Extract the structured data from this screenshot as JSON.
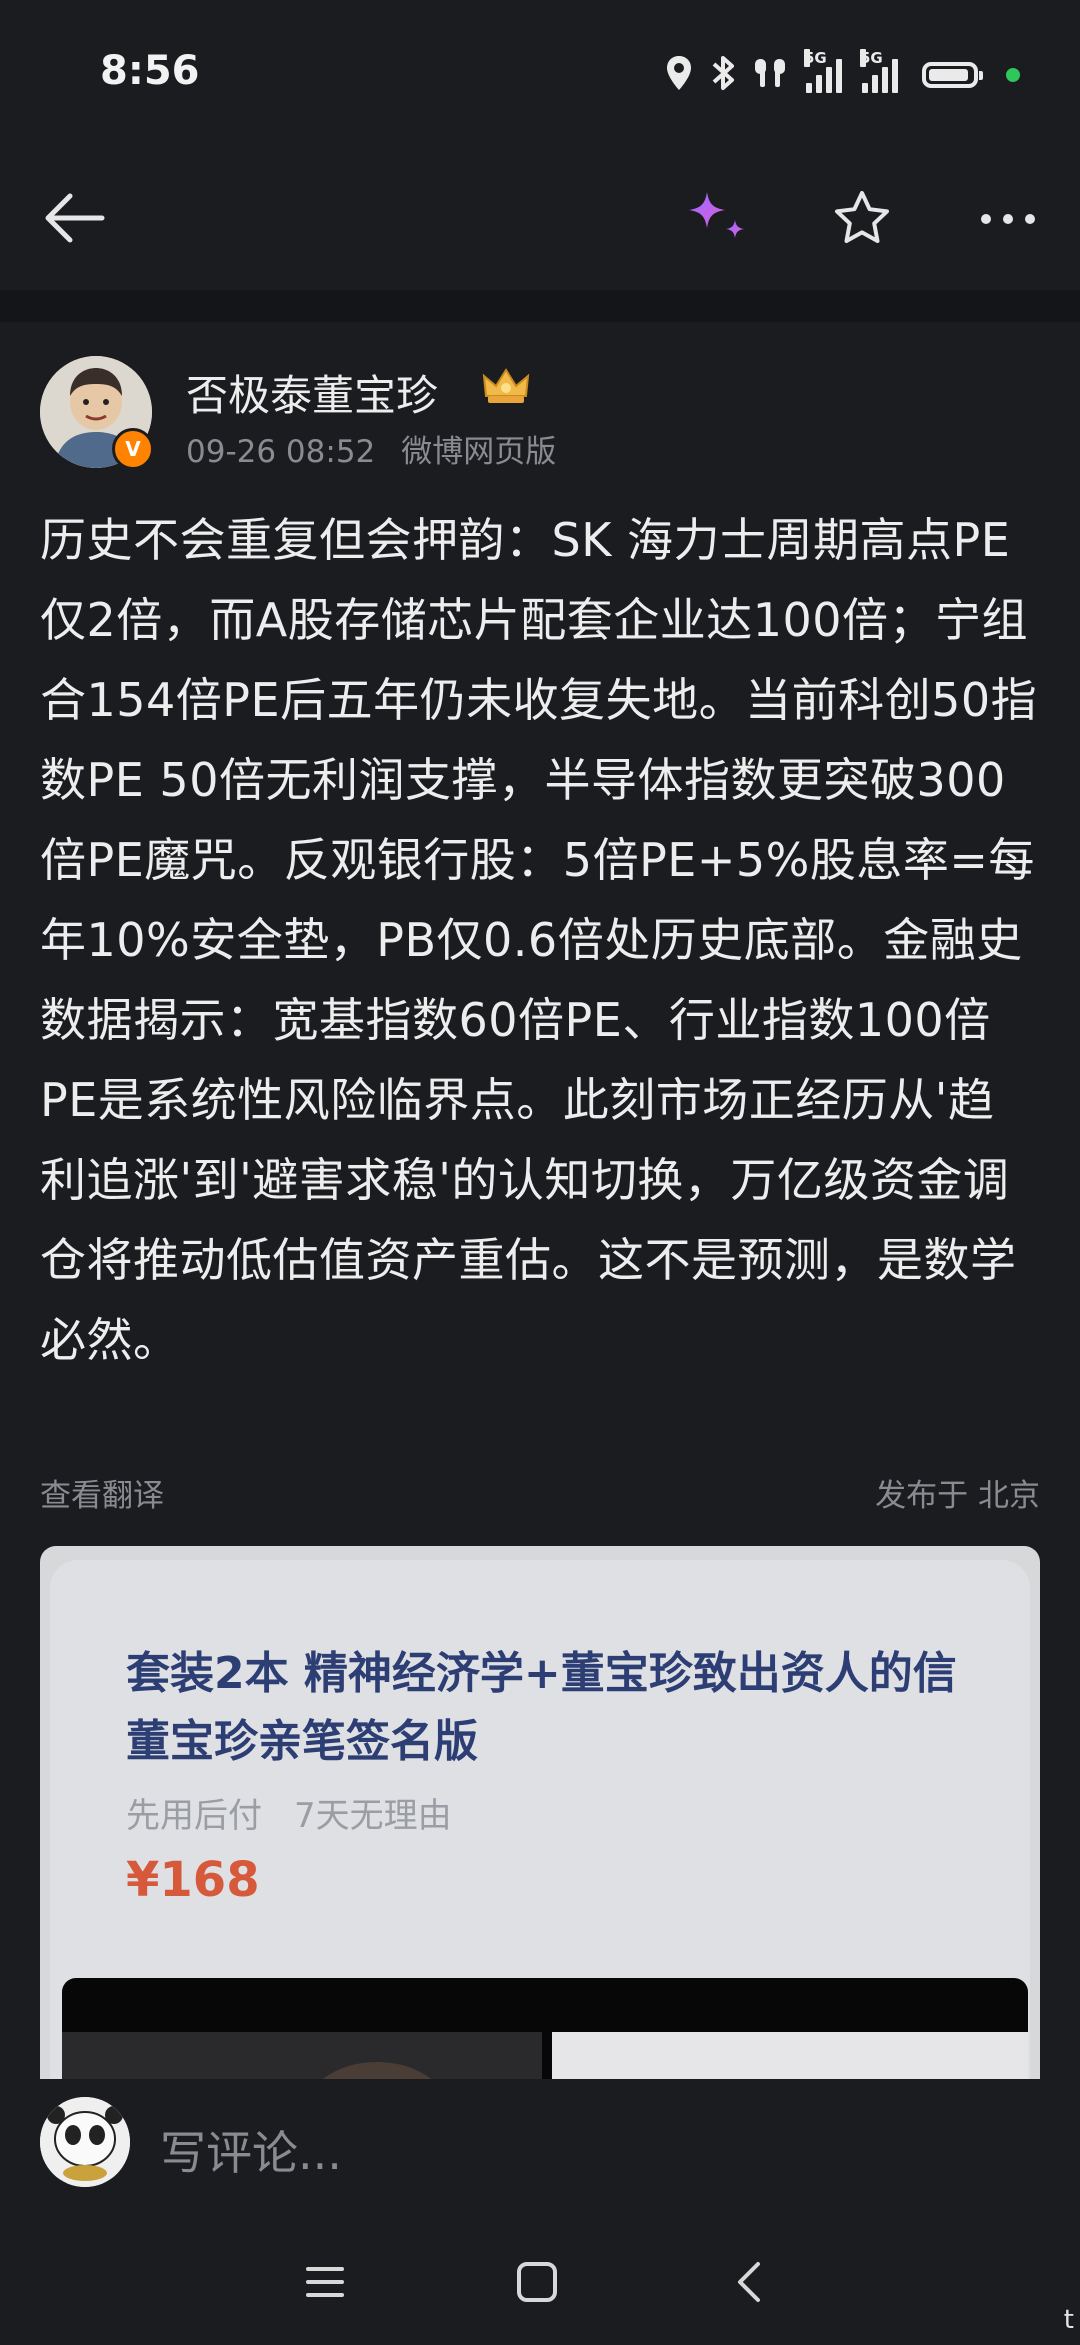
{
  "status_bar": {
    "time": "8:56",
    "network_1": "5G",
    "network_2": "5G",
    "icons": [
      "location-icon",
      "bluetooth-icon",
      "earbuds-icon",
      "signal-icon",
      "signal-icon",
      "battery-icon",
      "green-dot-icon"
    ]
  },
  "top_nav": {
    "icons": [
      "back-arrow-icon",
      "sparkle-ai-icon",
      "star-favorite-icon",
      "more-icon"
    ],
    "accent_gradient": [
      "#9a6bff",
      "#d95fe0"
    ]
  },
  "post": {
    "author": "否极泰董宝珍",
    "verified_badge": "V",
    "timestamp": "09-26 08:52",
    "source": "微博网页版",
    "body": "历史不会重复但会押韵：SK 海力士周期高点PE仅2倍，而A股存储芯片配套企业达100倍；宁组合154倍PE后五年仍未收复失地。当前科创50指数PE 50倍无利润支撑，半导体指数更突破300倍PE魔咒。反观银行股：5倍PE+5%股息率=每年10%安全垫，PB仅0.6倍处历史底部。金融史数据揭示：宽基指数60倍PE、行业指数100倍PE是系统性风险临界点。此刻市场正经历从'趋利追涨'到'避害求稳'的认知切换，万亿级资金调仓将推动低估值资产重估。这不是预测，是数学必然。",
    "translate_link": "查看翻译",
    "location": "发布于 北京"
  },
  "product_card": {
    "title": "套装2本 精神经济学+董宝珍致出资人的信 董宝珍亲笔签名版",
    "tag_1": "先用后付",
    "tag_2": "7天无理由",
    "price": "¥168"
  },
  "comment_bar": {
    "placeholder": "写评论..."
  },
  "system_nav": {
    "icons": [
      "menu-icon",
      "home-square-icon",
      "back-chevron-icon"
    ],
    "corner_letter": "t"
  },
  "colors": {
    "background": "#1b1c20",
    "price_red": "#d5593a",
    "title_blue": "#2c3e73",
    "badge_orange": "#ff8200"
  }
}
